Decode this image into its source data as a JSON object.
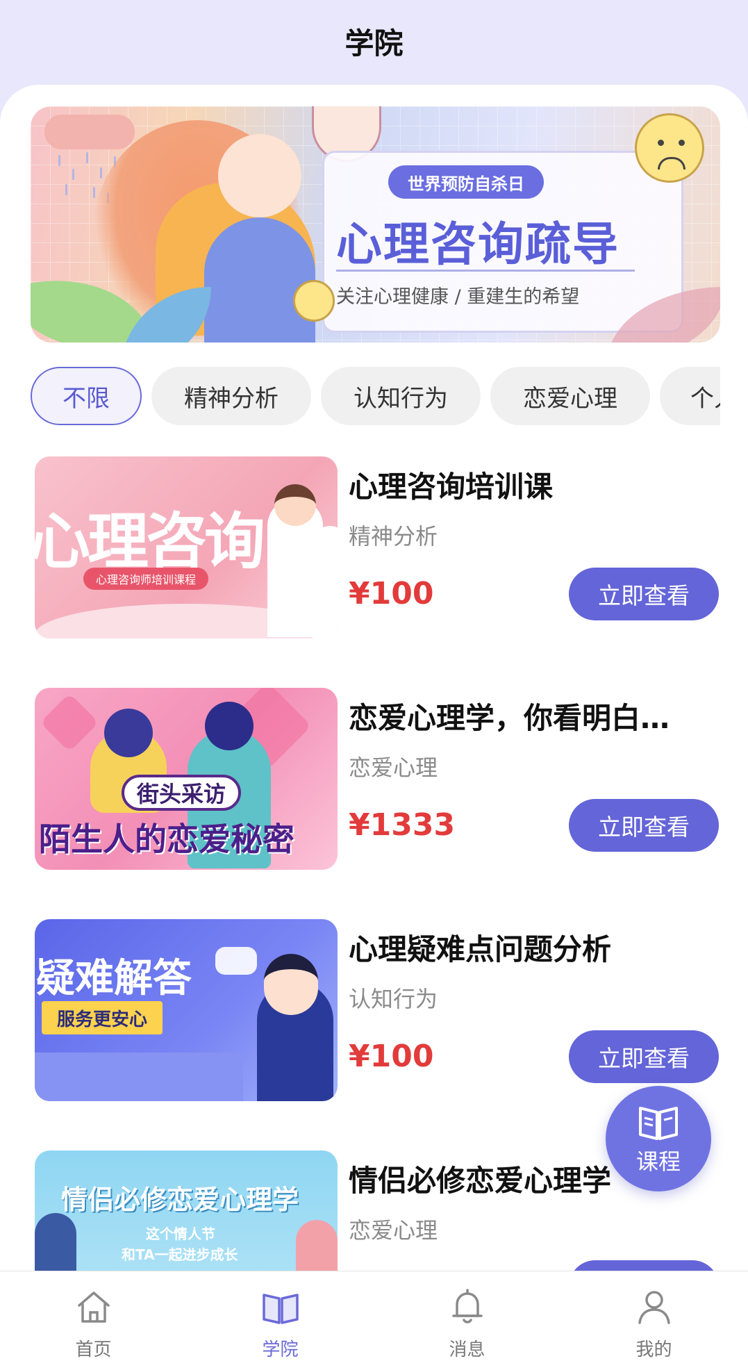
{
  "header": {
    "title": "学院"
  },
  "banner": {
    "tag": "世界预防自杀日",
    "title": "心理咨询疏导",
    "subtitle": "关注心理健康 / 重建生的希望"
  },
  "categories": [
    {
      "label": "不限",
      "active": true
    },
    {
      "label": "精神分析",
      "active": false
    },
    {
      "label": "认知行为",
      "active": false
    },
    {
      "label": "恋爱心理",
      "active": false
    },
    {
      "label": "个人",
      "active": false
    }
  ],
  "courses": [
    {
      "title": "心理咨询培训课",
      "category": "精神分析",
      "price": "¥100",
      "button": "立即查看",
      "thumb": {
        "big": "心理咨询",
        "pill": "心理咨询师培训课程"
      }
    },
    {
      "title": "恋爱心理学，你看明白…",
      "category": "恋爱心理",
      "price": "¥1333",
      "button": "立即查看",
      "thumb": {
        "bubble": "街头采访",
        "big": "陌生人的恋爱秘密"
      }
    },
    {
      "title": "心理疑难点问题分析",
      "category": "认知行为",
      "price": "¥100",
      "button": "立即查看",
      "thumb": {
        "big": "疑难解答",
        "band": "服务更安心"
      }
    },
    {
      "title": "情侣必修恋爱心理学",
      "category": "恋爱心理",
      "thumb": {
        "big": "情侣必修恋爱心理学",
        "line1": "这个情人节",
        "line2": "和TA一起进步成长"
      }
    }
  ],
  "fab": {
    "label": "课程",
    "icon": "book-icon"
  },
  "tabbar": [
    {
      "label": "首页",
      "icon": "home-icon",
      "active": false
    },
    {
      "label": "学院",
      "icon": "book-icon",
      "active": true
    },
    {
      "label": "消息",
      "icon": "bell-icon",
      "active": false
    },
    {
      "label": "我的",
      "icon": "user-icon",
      "active": false
    }
  ],
  "colors": {
    "accent": "#6465d8",
    "price": "#e23b3b",
    "header_bg": "#e9e7fb"
  }
}
